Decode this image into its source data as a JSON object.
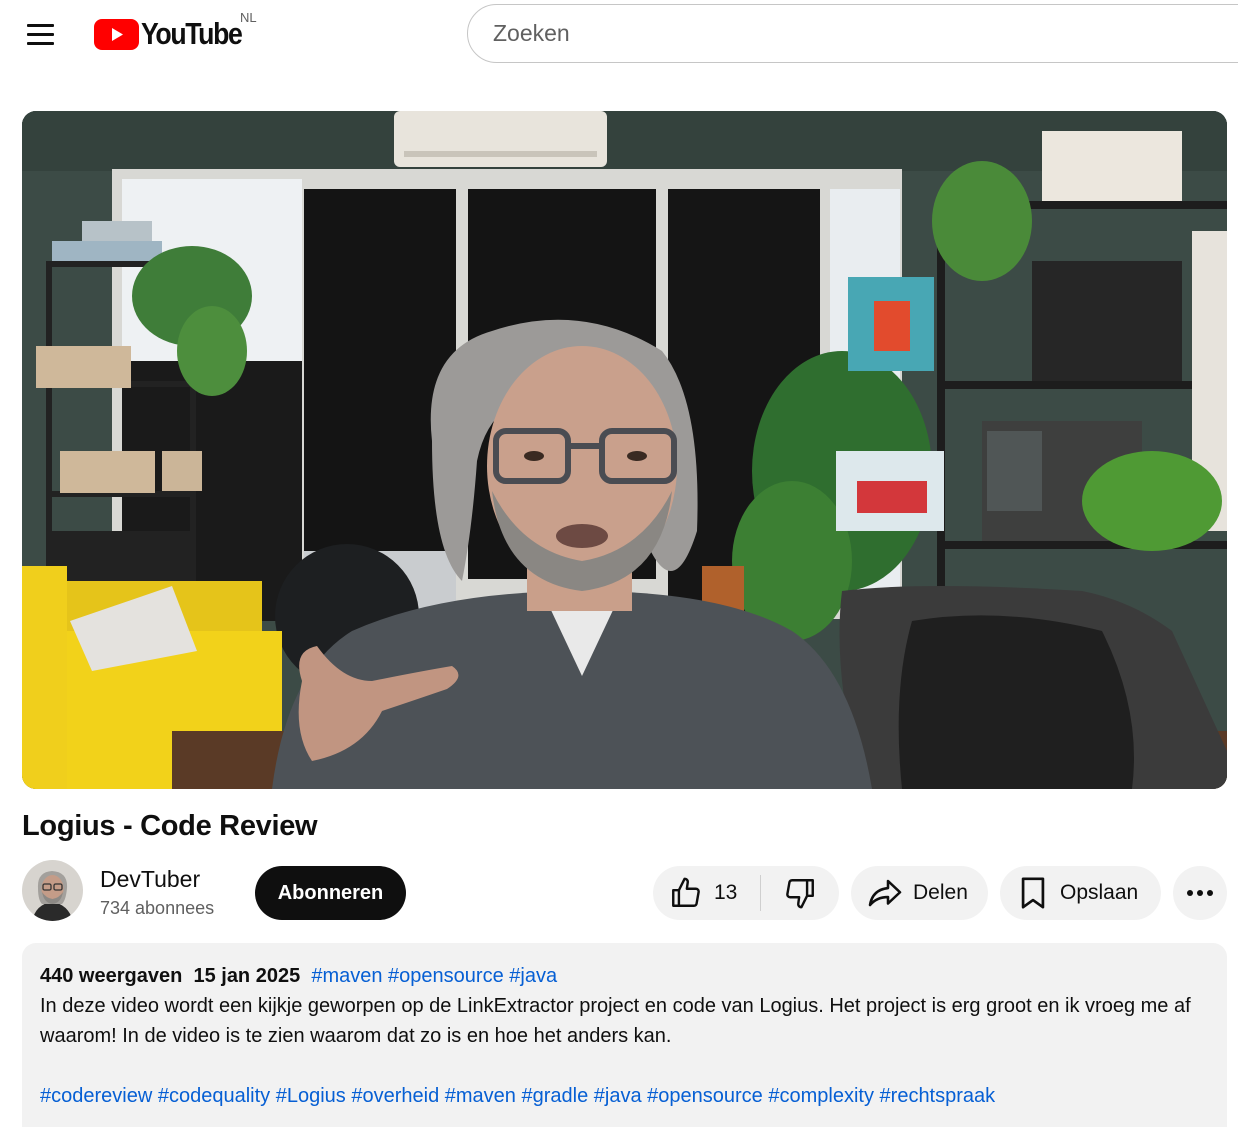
{
  "header": {
    "logo_text": "YouTube",
    "region": "NL",
    "search_placeholder": "Zoeken",
    "icons": [
      "menu-icon",
      "youtube-logo-icon"
    ]
  },
  "video": {
    "title": "Logius - Code Review"
  },
  "channel": {
    "name": "DevTuber",
    "subscribers": "734 abonnees",
    "subscribe_label": "Abonneren"
  },
  "actions": {
    "like_count": "13",
    "share_label": "Delen",
    "save_label": "Opslaan",
    "icons": [
      "thumbs-up-icon",
      "thumbs-down-icon",
      "share-arrow-icon",
      "bookmark-icon",
      "more-icon"
    ]
  },
  "description": {
    "views": "440 weergaven",
    "date": "15 jan 2025",
    "top_tags": [
      "#maven",
      "#opensource",
      "#java"
    ],
    "text": "In deze video wordt een kijkje geworpen op de LinkExtractor project en code van Logius. Het project is erg groot en ik vroeg me af waarom! In de video is te zien waarom dat zo is en hoe het anders kan.",
    "hashtags": [
      "#codereview",
      "#codequality",
      "#Logius",
      "#overheid",
      "#maven",
      "#gradle",
      "#java",
      "#opensource",
      "#complexity",
      "#rechtspraak"
    ]
  },
  "colors": {
    "brand_red": "#ff0000",
    "link_blue": "#065fd4",
    "pill_bg": "#f2f2f2",
    "text": "#0f0f0f",
    "muted": "#606060"
  }
}
